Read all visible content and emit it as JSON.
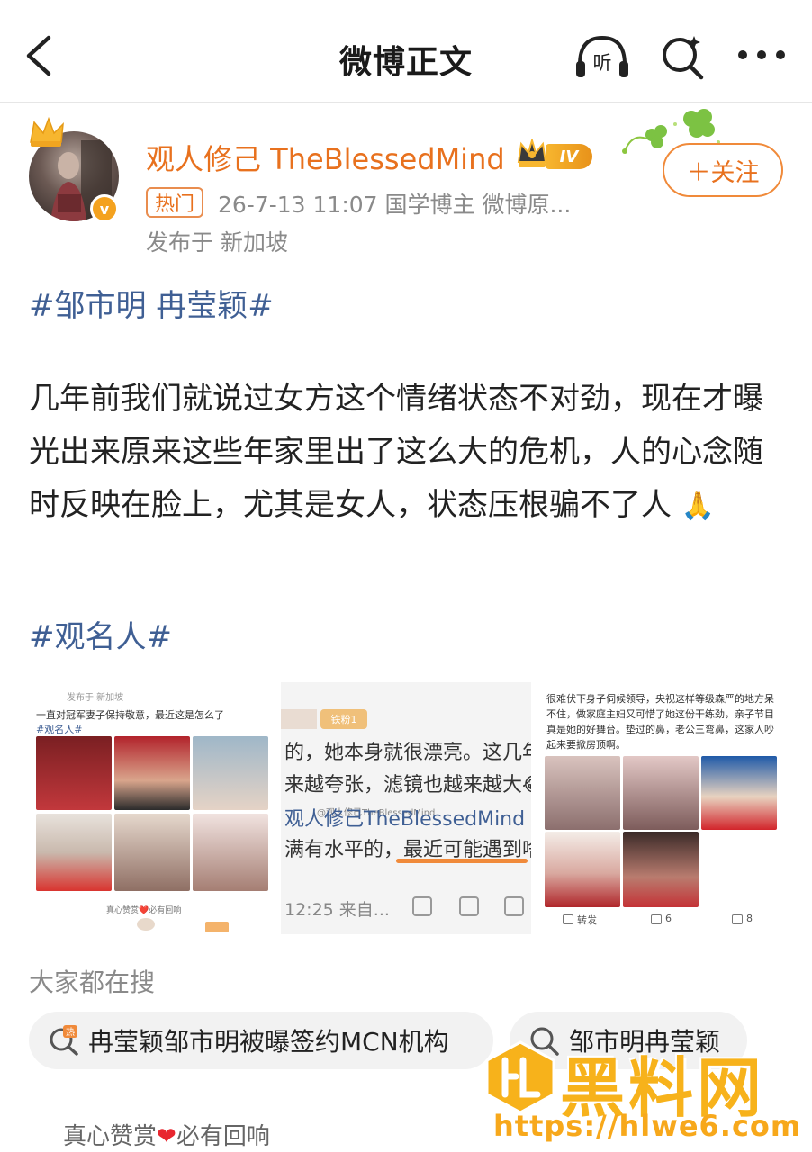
{
  "nav": {
    "title": "微博正文",
    "listen_label": "听"
  },
  "author": {
    "name": "观人修己 TheBlessedMind",
    "level": "IV",
    "hot_tag": "热门",
    "meta": "26-7-13 11:07  国学博主 微博原...",
    "location": "发布于 新加坡",
    "verified_mark": "v",
    "follow_label": "＋关注"
  },
  "post": {
    "hashtag1": "#邹市明 冉莹颖#",
    "text": "几年前我们就说过女方这个情绪状态不对劲，现在才曝光出来原来这些年家里出了这么大的危机，人的心念随时反映在脸上，尤其是女人，状态压根骗不了人",
    "emoji": "🙏",
    "hashtag2": "#观名人#"
  },
  "images": {
    "img1": {
      "meta": "发布于 新加坡",
      "caption": "一直对冠军妻子保持敬意，最近这是怎么了",
      "tag": "#观名人#",
      "footer": "真心赞赏❤️必有回响"
    },
    "img2": {
      "level": "铁粉1",
      "line_a": "的，她本身就很漂亮。这几年",
      "line_b": "来越夸张，滤镜也越来越大😂",
      "line_c": "观人修己TheBlessedMind 博主：以",
      "line_d": "满有水平的，最近可能遇到啥难",
      "watermark": "@观人修己TheBlessedMind",
      "footer": "12:25 来自..."
    },
    "img3": {
      "text": "很难伏下身子伺候领导，央视这样等级森严的地方呆不住，做家庭主妇又可惜了她这份干练劲，亲子节目真是她的好舞台。垫过的鼻，老公三弯鼻，这家人吵起来要掀房顶啊。",
      "repost": "转发",
      "comments": "6",
      "likes": "8"
    }
  },
  "search": {
    "title": "大家都在搜",
    "chip1": "冉莹颖邹市明被曝签约MCN机构",
    "chip2": "邹市明冉莹颖"
  },
  "watermark": {
    "text": "黑料网",
    "url": "https://hlwe6.com"
  },
  "reward": {
    "before": "真心赞赏",
    "heart": "❤",
    "after": "必有回响"
  },
  "colors": {
    "accent": "#e8711e",
    "link": "#3f5f94",
    "meta": "#8a8a8a",
    "watermark": "#f7b21b"
  }
}
